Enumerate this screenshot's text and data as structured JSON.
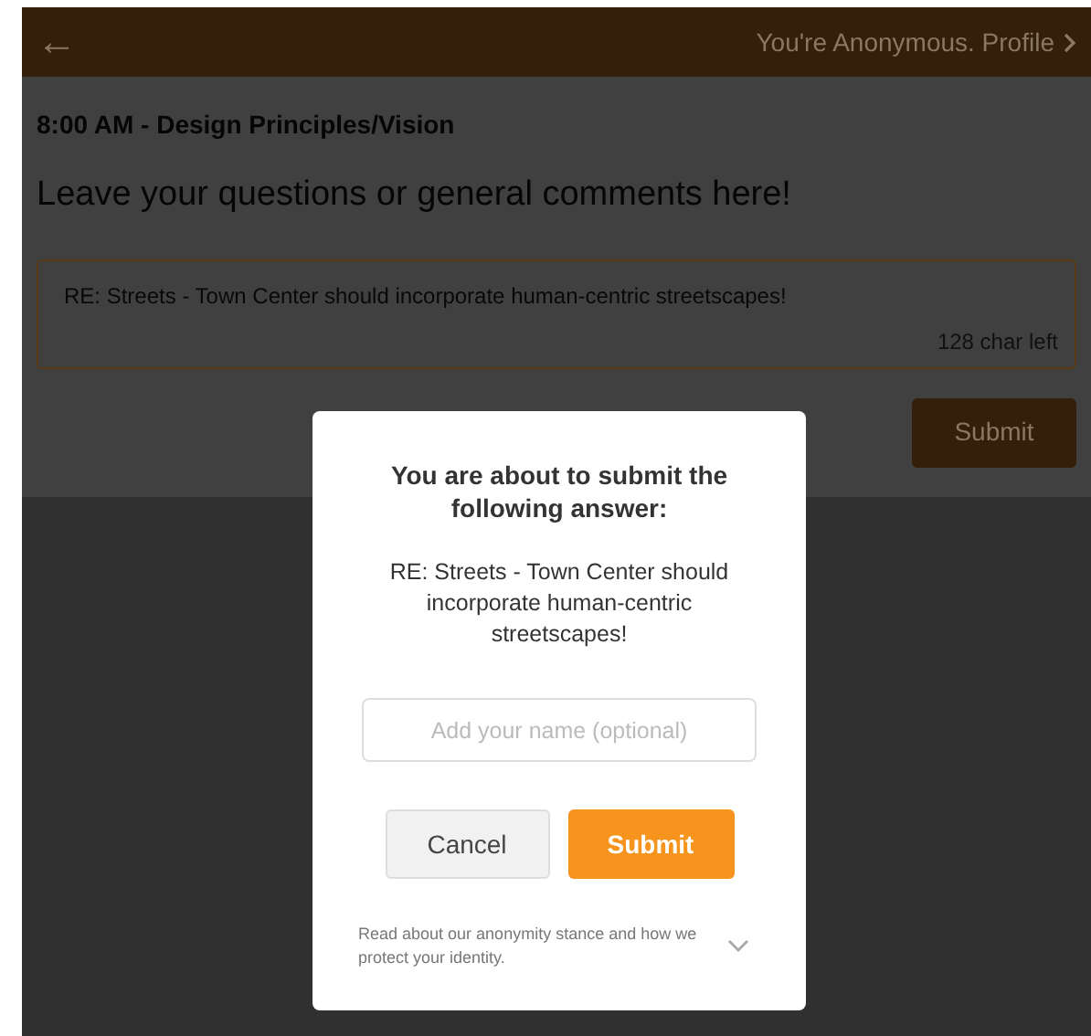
{
  "header": {
    "back_icon": "←",
    "profile_link": "You're Anonymous. Profile"
  },
  "session_title": "8:00 AM - Design Principles/Vision",
  "prompt": "Leave your questions or general comments here!",
  "comment_box": {
    "value": "RE: Streets - Town Center should incorporate human-centric streetscapes!",
    "counter": "128 char left"
  },
  "submit_button": "Submit",
  "dialog": {
    "heading": "You are about to submit the following answer:",
    "answer": "RE: Streets - Town Center should incorporate human-centric streetscapes!",
    "name_field": {
      "placeholder": "Add your name (optional)"
    },
    "buttons": [
      {
        "label": "Cancel",
        "kind": "secondary"
      },
      {
        "label": "Submit",
        "kind": "primary"
      }
    ],
    "footer_note": "Read about our anonymity stance and how we protect your identity.",
    "footer_expanded": false
  }
}
